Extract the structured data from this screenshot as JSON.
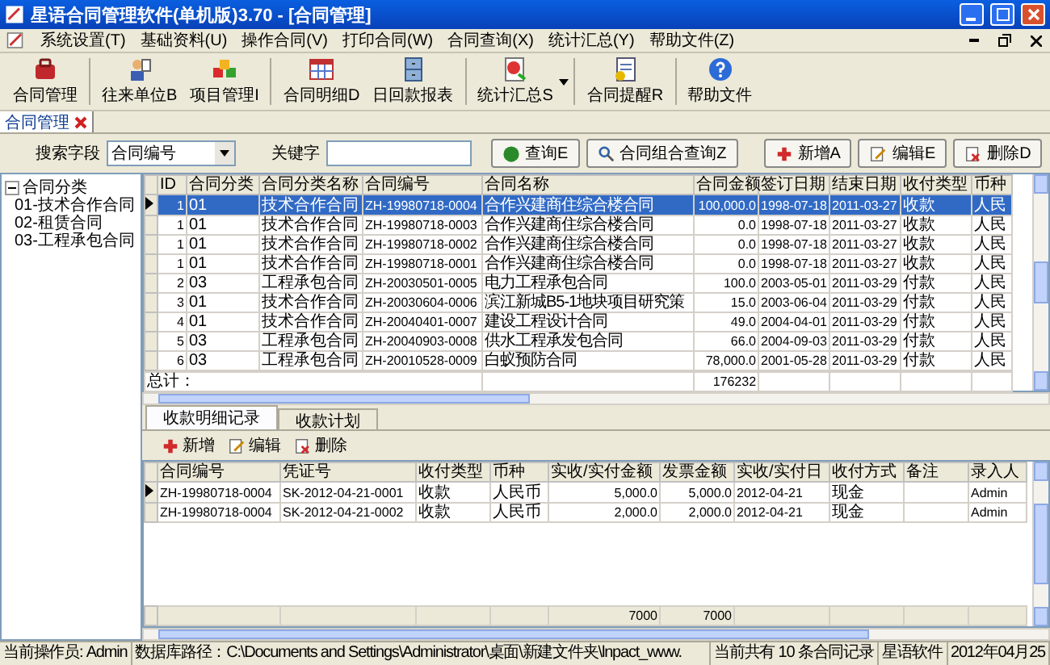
{
  "window": {
    "title": "星语合同管理软件(单机版)3.70 - [合同管理]"
  },
  "menu": [
    "系统设置(T)",
    "基础资料(U)",
    "操作合同(V)",
    "打印合同(W)",
    "合同查询(X)",
    "统计汇总(Y)",
    "帮助文件(Z)"
  ],
  "toolbar": [
    {
      "label": "合同管理"
    },
    {
      "label": "往来单位B"
    },
    {
      "label": "项目管理I"
    },
    {
      "label": "合同明细D"
    },
    {
      "label": "日回款报表"
    },
    {
      "label": "统计汇总S",
      "dropdown": true
    },
    {
      "label": "合同提醒R"
    },
    {
      "label": "帮助文件"
    }
  ],
  "doc_tabs": [
    {
      "label": "合同管理"
    }
  ],
  "search": {
    "field_label": "搜索字段",
    "field_value": "合同编号",
    "keyword_label": "关键字",
    "buttons": [
      "查询E",
      "合同组合查询Z",
      "新增A",
      "编辑E",
      "删除D"
    ]
  },
  "tree": {
    "label": "合同分类",
    "expanded": true,
    "children": [
      {
        "label": "01-技术合作合同"
      },
      {
        "label": "02-租赁合同"
      },
      {
        "label": "03-工程承包合同"
      }
    ]
  },
  "contracts": {
    "columns": [
      "ID",
      "合同分类",
      "合同分类名称",
      "合同编号",
      "合同名称",
      "合同金额",
      "签订日期",
      "结束日期",
      "收付类型",
      "币种"
    ],
    "rows": [
      {
        "selected": true,
        "cells": [
          "1",
          "01",
          "技术合作合同",
          "ZH-19980718-0004",
          "合作兴建商住综合楼合同",
          "100,000.0",
          "1998-07-18",
          "2011-03-27",
          "收款",
          "人民"
        ]
      },
      {
        "selected": false,
        "cells": [
          "1",
          "01",
          "技术合作合同",
          "ZH-19980718-0003",
          "合作兴建商住综合楼合同",
          "0.0",
          "1998-07-18",
          "2011-03-27",
          "收款",
          "人民"
        ]
      },
      {
        "selected": false,
        "cells": [
          "1",
          "01",
          "技术合作合同",
          "ZH-19980718-0002",
          "合作兴建商住综合楼合同",
          "0.0",
          "1998-07-18",
          "2011-03-27",
          "收款",
          "人民"
        ]
      },
      {
        "selected": false,
        "cells": [
          "1",
          "01",
          "技术合作合同",
          "ZH-19980718-0001",
          "合作兴建商住综合楼合同",
          "0.0",
          "1998-07-18",
          "2011-03-27",
          "收款",
          "人民"
        ]
      },
      {
        "selected": false,
        "cells": [
          "2",
          "03",
          "工程承包合同",
          "ZH-20030501-0005",
          "电力工程承包合同",
          "100.0",
          "2003-05-01",
          "2011-03-29",
          "付款",
          "人民"
        ]
      },
      {
        "selected": false,
        "cells": [
          "3",
          "01",
          "技术合作合同",
          "ZH-20030604-0006",
          "滨江新城B5-1地块项目研究策",
          "15.0",
          "2003-06-04",
          "2011-03-29",
          "付款",
          "人民"
        ]
      },
      {
        "selected": false,
        "cells": [
          "4",
          "01",
          "技术合作合同",
          "ZH-20040401-0007",
          "建设工程设计合同",
          "49.0",
          "2004-04-01",
          "2011-03-29",
          "付款",
          "人民"
        ]
      },
      {
        "selected": false,
        "cells": [
          "5",
          "03",
          "工程承包合同",
          "ZH-20040903-0008",
          "供水工程承发包合同",
          "66.0",
          "2004-09-03",
          "2011-03-29",
          "付款",
          "人民"
        ]
      },
      {
        "selected": false,
        "cells": [
          "6",
          "03",
          "工程承包合同",
          "ZH-20010528-0009",
          "白蚁预防合同",
          "78,000.0",
          "2001-05-28",
          "2011-03-29",
          "付款",
          "人民"
        ]
      }
    ],
    "total_label": "总计：",
    "total": "176232"
  },
  "detail": {
    "tabs": [
      {
        "label": "收款明细记录",
        "selected": true
      },
      {
        "label": "收款计划",
        "selected": false
      }
    ],
    "buttons": [
      "新增",
      "编辑",
      "删除"
    ],
    "columns": [
      "合同编号",
      "凭证号",
      "收付类型",
      "币种",
      "实收/实付金额",
      "发票金额",
      "实收/实付日",
      "收付方式",
      "备注",
      "录入人"
    ],
    "rows": [
      {
        "selected": true,
        "cells": [
          "ZH-19980718-0004",
          "SK-2012-04-21-0001",
          "收款",
          "人民币",
          "5,000.0",
          "5,000.0",
          "2012-04-21",
          "现金",
          null,
          "Admin"
        ]
      },
      {
        "selected": false,
        "cells": [
          "ZH-19980718-0004",
          "SK-2012-04-21-0002",
          "收款",
          "人民币",
          "2,000.0",
          "2,000.0",
          "2012-04-21",
          "现金",
          null,
          "Admin"
        ]
      }
    ],
    "totals": {
      "amount": "7000",
      "invoice_amount": "7000"
    }
  },
  "status_bar": [
    "当前操作员: Admin",
    "数据库路径：C:\\Documents and Settings\\Administrator\\桌面\\新建文件夹\\lnpact_www.",
    "当前共有 10 条合同记录",
    "星语软件",
    "2012年04月25"
  ]
}
